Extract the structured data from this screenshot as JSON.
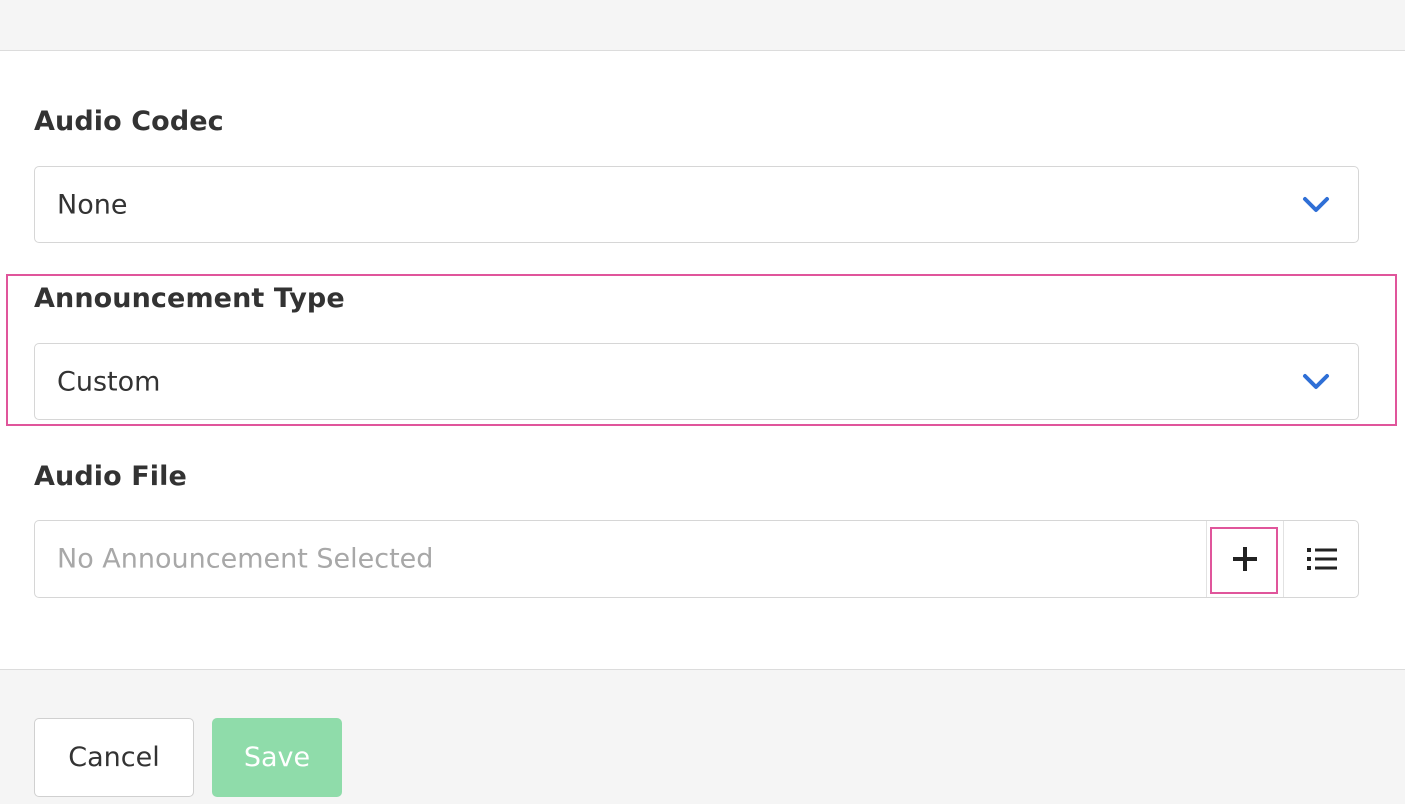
{
  "audio_codec": {
    "label": "Audio Codec",
    "selected": "None"
  },
  "announcement_type": {
    "label": "Announcement Type",
    "selected": "Custom"
  },
  "audio_file": {
    "label": "Audio File",
    "placeholder": "No Announcement Selected",
    "add_icon": "plus-icon",
    "list_icon": "list-icon"
  },
  "footer": {
    "cancel_label": "Cancel",
    "save_label": "Save"
  },
  "colors": {
    "accent": "#2f6fd6",
    "highlight": "#e0559b",
    "save_button": "#8fdcaa"
  }
}
